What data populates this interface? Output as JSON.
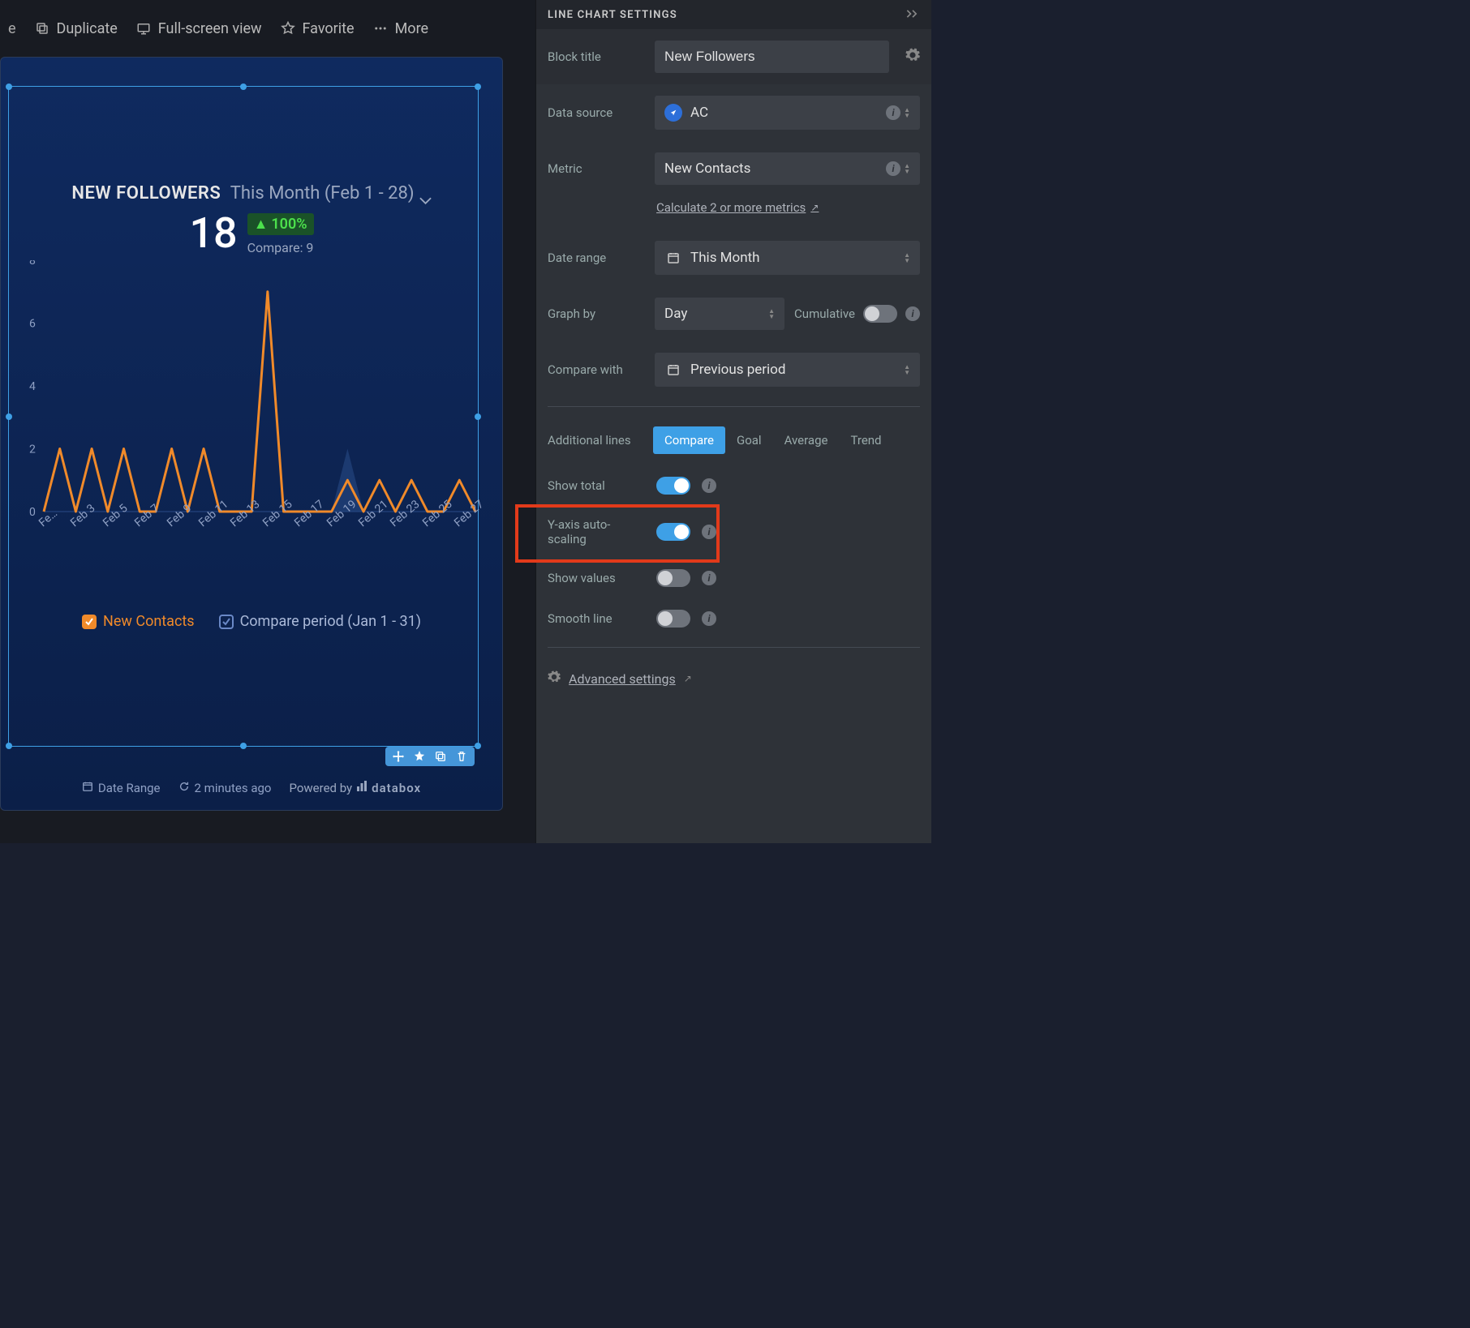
{
  "toolbar": {
    "duplicate": "Duplicate",
    "fullscreen": "Full-screen view",
    "favorite": "Favorite",
    "more": "More"
  },
  "chart_header": {
    "title": "NEW FOLLOWERS",
    "date_range": "This Month (Feb 1 - 28)",
    "big_value": "18",
    "pct_change": "100%",
    "compare_text": "Compare: 9"
  },
  "legend": {
    "primary": "New Contacts",
    "compare": "Compare period (Jan 1 - 31)"
  },
  "footer": {
    "date_range_btn": "Date Range",
    "updated": "2 minutes ago",
    "powered_by": "Powered by",
    "brand": "databox"
  },
  "panel": {
    "header": "LINE CHART SETTINGS",
    "block_title_label": "Block title",
    "block_title_value": "New Followers",
    "data_source_label": "Data source",
    "data_source_value": "AC",
    "metric_label": "Metric",
    "metric_value": "New Contacts",
    "calc_link": "Calculate 2 or more metrics",
    "date_range_label": "Date range",
    "date_range_value": "This Month",
    "graph_by_label": "Graph by",
    "graph_by_value": "Day",
    "cumulative_label": "Cumulative",
    "compare_with_label": "Compare with",
    "compare_with_value": "Previous period",
    "additional_lines_label": "Additional lines",
    "tabs": [
      "Compare",
      "Goal",
      "Average",
      "Trend"
    ],
    "show_total_label": "Show total",
    "yaxis_label": "Y-axis auto-scaling",
    "show_values_label": "Show values",
    "smooth_line_label": "Smooth line",
    "advanced_label": "Advanced settings"
  },
  "chart_data": {
    "type": "line",
    "title": "New Followers",
    "ylabel": "",
    "xlabel": "",
    "ylim": [
      0,
      8
    ],
    "yticks": [
      0,
      2,
      4,
      6,
      8
    ],
    "x_visible_labels": [
      "Fe…",
      "Feb 3",
      "Feb 5",
      "Feb 7",
      "Feb 9",
      "Feb 11",
      "Feb 13",
      "Feb 15",
      "Feb 17",
      "Feb 19",
      "Feb 21",
      "Feb 23",
      "Feb 25",
      "Feb 27"
    ],
    "series": [
      {
        "name": "New Contacts",
        "color": "#f08a2a",
        "x": [
          1,
          2,
          3,
          4,
          5,
          6,
          7,
          8,
          9,
          10,
          11,
          12,
          13,
          14,
          15,
          16,
          17,
          18,
          19,
          20,
          21,
          22,
          23,
          24,
          25,
          26,
          27,
          28
        ],
        "values": [
          0,
          2,
          0,
          2,
          0,
          2,
          0,
          0,
          2,
          0,
          2,
          0,
          0,
          0,
          7,
          0,
          0,
          0,
          0,
          1,
          0,
          1,
          0,
          1,
          0,
          0,
          1,
          0
        ]
      },
      {
        "name": "Compare period (Jan 1 - 31)",
        "color": "#34507f",
        "x": [
          1,
          2,
          3,
          4,
          5,
          6,
          7,
          8,
          9,
          10,
          11,
          12,
          13,
          14,
          15,
          16,
          17,
          18,
          19,
          20,
          21,
          22,
          23,
          24,
          25,
          26,
          27,
          28
        ],
        "values": [
          0,
          0,
          0,
          0,
          0,
          0,
          0,
          0,
          0,
          0,
          0,
          0,
          0,
          0,
          0,
          0,
          0,
          0,
          0,
          2,
          0,
          0,
          0,
          0,
          0,
          0,
          0,
          0
        ]
      }
    ]
  }
}
